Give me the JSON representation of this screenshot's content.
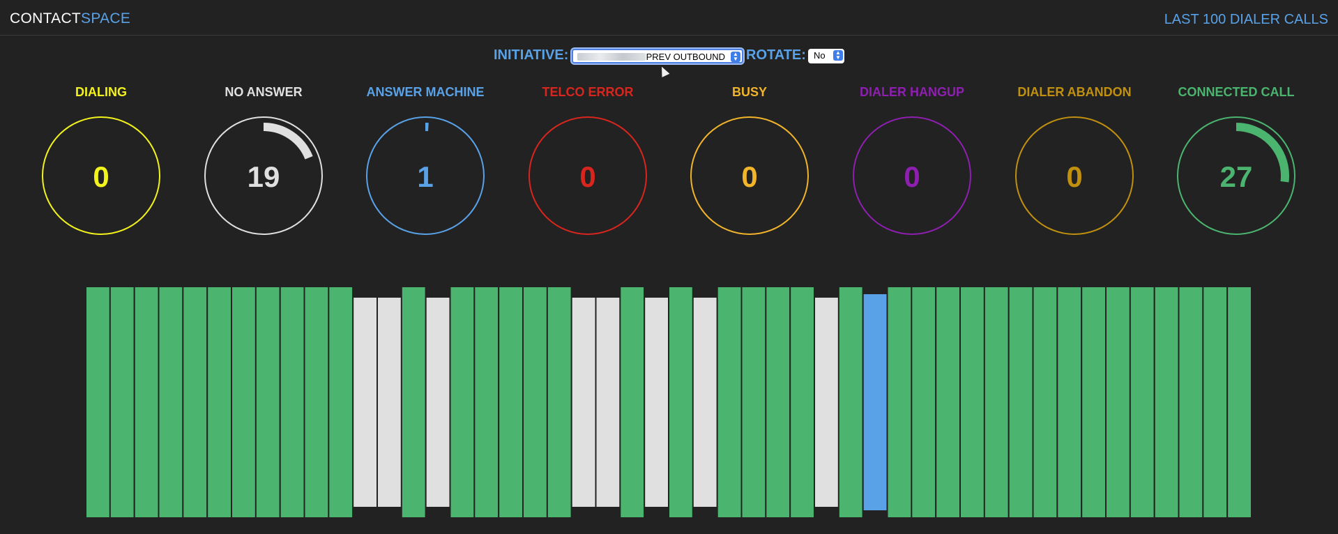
{
  "header": {
    "brand_part1": "CONTACT",
    "brand_part2": "SPACE",
    "last_calls_link": "LAST 100 DIALER CALLS"
  },
  "controls": {
    "initiative_label": "INITIATIVE:",
    "initiative_value": "PREV OUTBOUND",
    "rotate_label": "ROTATE:",
    "rotate_value": "No"
  },
  "gauges": [
    {
      "label": "DIALING",
      "value": "0",
      "fraction": 0,
      "color": "#f2f21c"
    },
    {
      "label": "NO ANSWER",
      "value": "19",
      "fraction": 0.19,
      "color": "#e0e0e0"
    },
    {
      "label": "ANSWER MACHINE",
      "value": "1",
      "fraction": 0.01,
      "color": "#5aa2e8"
    },
    {
      "label": "TELCO ERROR",
      "value": "0",
      "fraction": 0,
      "color": "#d8261e"
    },
    {
      "label": "BUSY",
      "value": "0",
      "fraction": 0,
      "color": "#f2b42a"
    },
    {
      "label": "DIALER HANGUP",
      "value": "0",
      "fraction": 0,
      "color": "#8e1fb0"
    },
    {
      "label": "DIALER ABANDON",
      "value": "0",
      "fraction": 0,
      "color": "#c0900e"
    },
    {
      "label": "CONNECTED CALL",
      "value": "27",
      "fraction": 0.27,
      "color": "#4bb56f"
    }
  ],
  "recent_calls": [
    "connected",
    "connected",
    "connected",
    "connected",
    "connected",
    "connected",
    "connected",
    "connected",
    "connected",
    "connected",
    "connected",
    "no_answer",
    "no_answer",
    "connected",
    "no_answer",
    "connected",
    "connected",
    "connected",
    "connected",
    "connected",
    "no_answer",
    "no_answer",
    "connected",
    "no_answer",
    "connected",
    "no_answer",
    "connected",
    "connected",
    "connected",
    "connected",
    "no_answer",
    "connected",
    "answer_machine",
    "connected",
    "connected",
    "connected",
    "connected",
    "connected",
    "connected",
    "connected",
    "connected",
    "connected",
    "connected",
    "connected",
    "connected",
    "connected",
    "connected",
    "connected"
  ],
  "status_colors": {
    "connected": "#4bb56f",
    "no_answer": "#e0e0e0",
    "answer_machine": "#5aa2e8"
  }
}
